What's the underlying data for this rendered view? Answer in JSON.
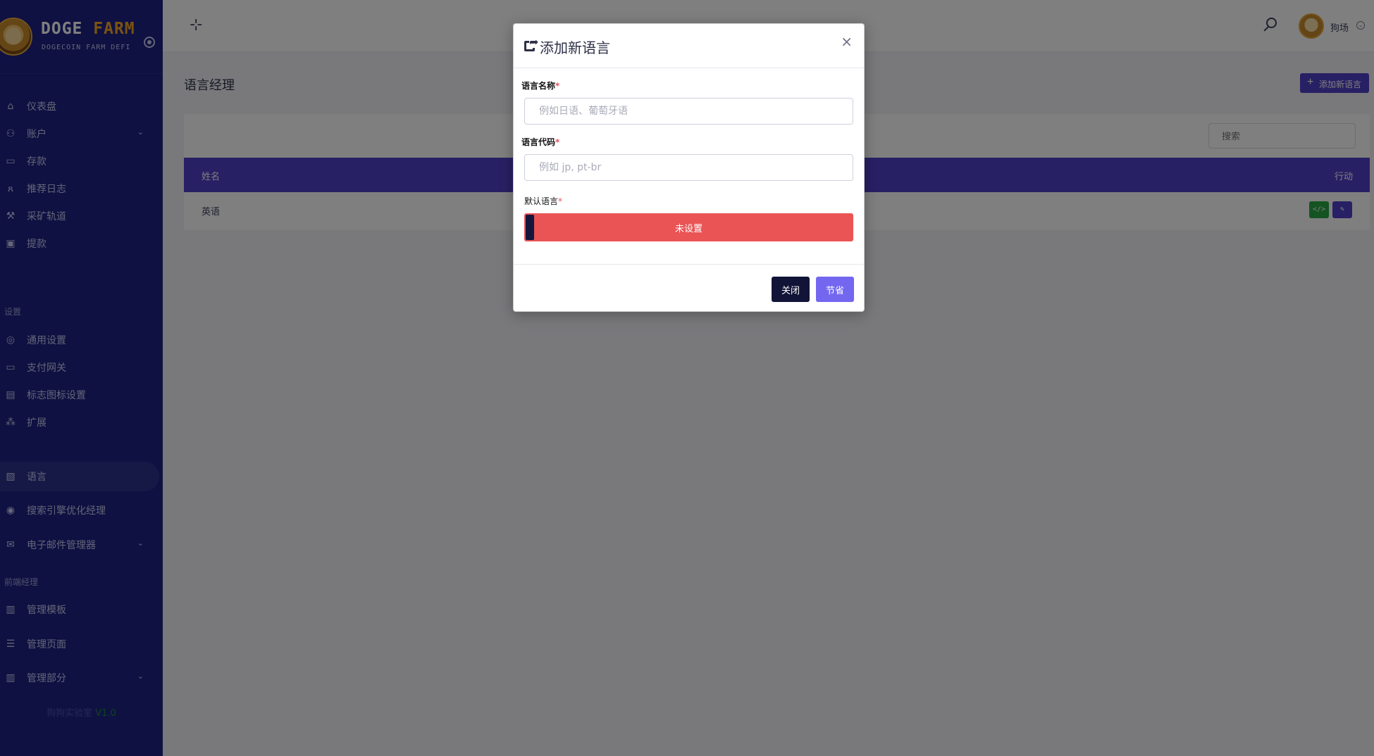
{
  "brand": {
    "title_word1": "DOGE",
    "title_word2": "FARM",
    "subtitle": "DOGECOIN FARM DEFI"
  },
  "sidebar": {
    "items": [
      {
        "label": "仪表盘",
        "icon": "home-icon"
      },
      {
        "label": "账户",
        "icon": "users-icon",
        "has_submenu": true
      },
      {
        "label": "存款",
        "icon": "wallet-icon"
      },
      {
        "label": "推荐日志",
        "icon": "referral-icon"
      },
      {
        "label": "采矿轨道",
        "icon": "pickaxe-icon"
      },
      {
        "label": "提款",
        "icon": "withdraw-icon"
      }
    ],
    "section_settings": "设置",
    "settings_items": [
      {
        "label": "通用设置",
        "icon": "settings-icon"
      },
      {
        "label": "支付网关",
        "icon": "card-icon"
      },
      {
        "label": "标志图标设置",
        "icon": "image-icon"
      },
      {
        "label": "扩展",
        "icon": "extension-icon"
      },
      {
        "label": "语言",
        "icon": "language-icon",
        "active": true
      },
      {
        "label": "搜索引擎优化经理",
        "icon": "globe-icon"
      },
      {
        "label": "电子邮件管理器",
        "icon": "mail-icon",
        "has_submenu": true
      }
    ],
    "section_frontend": "前端经理",
    "frontend_items": [
      {
        "label": "管理模板",
        "icon": "template-icon"
      },
      {
        "label": "管理页面",
        "icon": "list-icon"
      },
      {
        "label": "管理部分",
        "icon": "section-icon",
        "has_submenu": true
      }
    ],
    "footer_text": "狗狗实验室",
    "footer_version": "V1.0"
  },
  "topbar": {
    "user_name": "狗场"
  },
  "main": {
    "page_title": "语言经理",
    "add_button_label": "添加新语言",
    "search_placeholder": "搜索",
    "table": {
      "columns": [
        "姓名",
        "行动"
      ],
      "rows": [
        {
          "name": "英语"
        }
      ]
    }
  },
  "modal": {
    "title": "添加新语言",
    "name_label": "语言名称",
    "name_placeholder": "例如日语、葡萄牙语",
    "code_label": "语言代码",
    "code_placeholder": "例如 jp, pt-br",
    "default_label": "默认语言",
    "required_mark": "*",
    "toggle_label": "未设置",
    "close_button": "关闭",
    "save_button": "节省"
  },
  "colors": {
    "sidebar_bg": "#1e2385",
    "accent": "#5141c9",
    "toggle_off": "#ea5455",
    "save_button": "#7367f0",
    "close_button": "#111436"
  }
}
